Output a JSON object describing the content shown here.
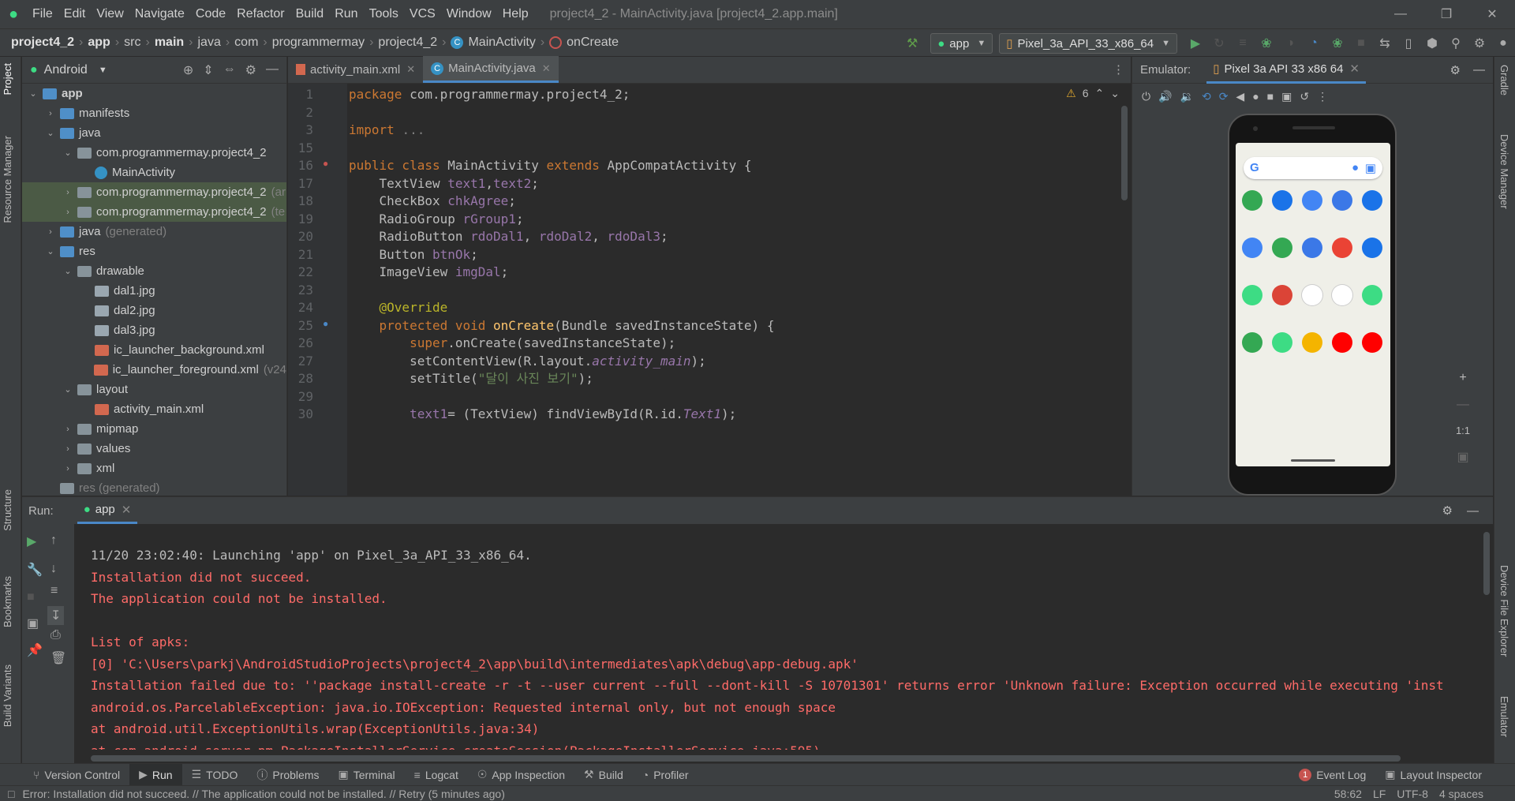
{
  "menubar": {
    "items": [
      "File",
      "Edit",
      "View",
      "Navigate",
      "Code",
      "Refactor",
      "Build",
      "Run",
      "Tools",
      "VCS",
      "Window",
      "Help"
    ],
    "title": "project4_2 - MainActivity.java [project4_2.app.main]"
  },
  "breadcrumb": {
    "items": [
      "project4_2",
      "app",
      "src",
      "main",
      "java",
      "com",
      "programmermay",
      "project4_2",
      "MainActivity",
      "onCreate"
    ]
  },
  "toolbar": {
    "run_config": "app",
    "device": "Pixel_3a_API_33_x86_64"
  },
  "left_tabs": {
    "project": "Project",
    "resource_manager": "Resource Manager",
    "structure": "Structure",
    "bookmarks": "Bookmarks",
    "build_variants": "Build Variants"
  },
  "right_tabs": {
    "gradle": "Gradle",
    "device_manager": "Device Manager",
    "device_file_explorer": "Device File Explorer",
    "emulator": "Emulator"
  },
  "project": {
    "view": "Android",
    "tree": [
      {
        "label": "app",
        "indent": 0,
        "icon": "fold blue",
        "open": true,
        "bold": true
      },
      {
        "label": "manifests",
        "indent": 1,
        "icon": "fold blue",
        "open": false
      },
      {
        "label": "java",
        "indent": 1,
        "icon": "fold blue",
        "open": true
      },
      {
        "label": "com.programmermay.project4_2",
        "indent": 2,
        "icon": "fold",
        "open": true
      },
      {
        "label": "MainActivity",
        "indent": 3,
        "icon": "cls",
        "leaf": true
      },
      {
        "label": "com.programmermay.project4_2",
        "suffix": "(ar",
        "indent": 2,
        "icon": "fold",
        "open": false,
        "sel": true
      },
      {
        "label": "com.programmermay.project4_2",
        "suffix": "(te",
        "indent": 2,
        "icon": "fold",
        "open": false,
        "sel": true
      },
      {
        "label": "java",
        "suffix": "(generated)",
        "indent": 1,
        "icon": "fold blue",
        "open": false
      },
      {
        "label": "res",
        "indent": 1,
        "icon": "fold blue",
        "open": true
      },
      {
        "label": "drawable",
        "indent": 2,
        "icon": "fold",
        "open": true
      },
      {
        "label": "dal1.jpg",
        "indent": 3,
        "icon": "img",
        "leaf": true
      },
      {
        "label": "dal2.jpg",
        "indent": 3,
        "icon": "img",
        "leaf": true
      },
      {
        "label": "dal3.jpg",
        "indent": 3,
        "icon": "img",
        "leaf": true
      },
      {
        "label": "ic_launcher_background.xml",
        "indent": 3,
        "icon": "xml",
        "leaf": true
      },
      {
        "label": "ic_launcher_foreground.xml",
        "suffix": "(v24",
        "indent": 3,
        "icon": "xml",
        "leaf": true
      },
      {
        "label": "layout",
        "indent": 2,
        "icon": "fold",
        "open": true
      },
      {
        "label": "activity_main.xml",
        "indent": 3,
        "icon": "xml",
        "leaf": true
      },
      {
        "label": "mipmap",
        "indent": 2,
        "icon": "fold",
        "open": false
      },
      {
        "label": "values",
        "indent": 2,
        "icon": "fold",
        "open": false
      },
      {
        "label": "xml",
        "indent": 2,
        "icon": "fold",
        "open": false
      },
      {
        "label": "res (generated)",
        "indent": 1,
        "icon": "fold",
        "dim": true,
        "leaf": true
      }
    ]
  },
  "editor": {
    "tabs": [
      "activity_main.xml",
      "MainActivity.java"
    ],
    "warnings": "6",
    "lines": [
      {
        "n": "1",
        "html": "<span class='kw'>package</span> com.programmermay.project4_2;"
      },
      {
        "n": "2",
        "html": ""
      },
      {
        "n": "3",
        "html": "<span class='kw'>import</span> <span class='fd'>...</span>"
      },
      {
        "n": "15",
        "html": ""
      },
      {
        "n": "16",
        "html": "<span class='kw'>public class</span> MainActivity <span class='kw'>extends</span> AppCompatActivity {"
      },
      {
        "n": "17",
        "html": "    TextView <span class='fld'>text1</span>,<span class='fld'>text2</span>;"
      },
      {
        "n": "18",
        "html": "    CheckBox <span class='fld'>chkAgree</span>;"
      },
      {
        "n": "19",
        "html": "    RadioGroup <span class='fld'>rGroup1</span>;"
      },
      {
        "n": "20",
        "html": "    RadioButton <span class='fld'>rdoDal1</span>, <span class='fld'>rdoDal2</span>, <span class='fld'>rdoDal3</span>;"
      },
      {
        "n": "21",
        "html": "    Button <span class='fld'>btnOk</span>;"
      },
      {
        "n": "22",
        "html": "    ImageView <span class='fld'>imgDal</span>;"
      },
      {
        "n": "23",
        "html": ""
      },
      {
        "n": "24",
        "html": "    <span class='an'>@Override</span>"
      },
      {
        "n": "25",
        "html": "    <span class='kw'>protected void</span> <span class='fn'>onCreate</span>(Bundle savedInstanceState) {"
      },
      {
        "n": "26",
        "html": "        <span class='kw'>super</span>.onCreate(savedInstanceState);"
      },
      {
        "n": "27",
        "html": "        setContentView(R.layout.<span class='it'>activity_main</span>);"
      },
      {
        "n": "28",
        "html": "        setTitle(<span class='st'>\"달이 사진 보기\"</span>);"
      },
      {
        "n": "29",
        "html": ""
      },
      {
        "n": "30",
        "html": "        <span class='fld'>text1</span>= (TextView) findViewById(R.id.<span class='it'>Text1</span>);"
      }
    ]
  },
  "emulator": {
    "label": "Emulator:",
    "tab": "Pixel 3a API 33 x86 64",
    "zoom_label": "1:1"
  },
  "run": {
    "label": "Run:",
    "tab": "app",
    "console": [
      {
        "cls": "norm",
        "text": "11/20 23:02:40: Launching 'app' on Pixel_3a_API_33_x86_64."
      },
      {
        "cls": "err",
        "text": "Installation did not succeed."
      },
      {
        "cls": "err",
        "text": "The application could not be installed."
      },
      {
        "cls": "err",
        "text": ""
      },
      {
        "cls": "err",
        "text": "List of apks:"
      },
      {
        "cls": "err",
        "text": "[0] 'C:\\Users\\parkj\\AndroidStudioProjects\\project4_2\\app\\build\\intermediates\\apk\\debug\\app-debug.apk'"
      },
      {
        "cls": "err",
        "text": "Installation failed due to: ''package install-create -r -t --user current --full --dont-kill -S 10701301' returns error 'Unknown failure: Exception occurred while executing 'inst"
      },
      {
        "cls": "err",
        "text": "android.os.ParcelableException: java.io.IOException: Requested internal only, but not enough space"
      },
      {
        "cls": "err",
        "text": "at android.util.ExceptionUtils.wrap(ExceptionUtils.java:34)"
      },
      {
        "cls": "err",
        "text": "at com.android.server.pm.PackageInstallerService.createSession(PackageInstallerService.java:595)"
      }
    ]
  },
  "bottom_tabs": [
    "Version Control",
    "Run",
    "TODO",
    "Problems",
    "Terminal",
    "Logcat",
    "App Inspection",
    "Build",
    "Profiler"
  ],
  "bottom_right": {
    "event_log": "Event Log",
    "event_count": "1",
    "layout_inspector": "Layout Inspector"
  },
  "status": {
    "message": "Error: Installation did not succeed. // The application could not be installed. // Retry (5 minutes ago)",
    "position": "58:62",
    "line_sep": "LF",
    "encoding": "UTF-8",
    "indent": "4 spaces"
  }
}
